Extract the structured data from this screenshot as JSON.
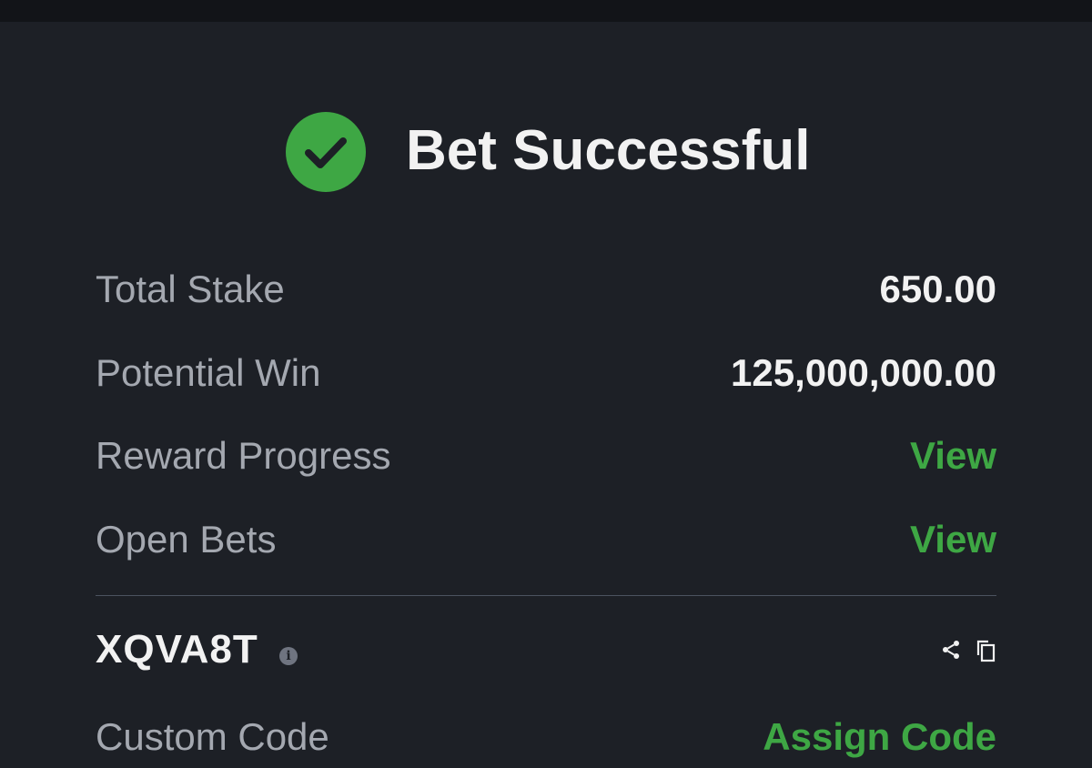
{
  "header": {
    "title": "Bet Successful",
    "icon": "check-circle-icon",
    "success_color": "#3ea744"
  },
  "summary": [
    {
      "label": "Total Stake",
      "value": "650.00"
    },
    {
      "label": "Potential Win",
      "value": "125,000,000.00"
    },
    {
      "label": "Reward Progress",
      "link": "View"
    },
    {
      "label": "Open Bets",
      "link": "View"
    }
  ],
  "booking": {
    "code": "XQVA8T",
    "info_icon": "info-icon",
    "share_icon": "share-icon",
    "copy_icon": "copy-icon"
  },
  "custom_code": {
    "label": "Custom Code",
    "action": "Assign Code"
  }
}
